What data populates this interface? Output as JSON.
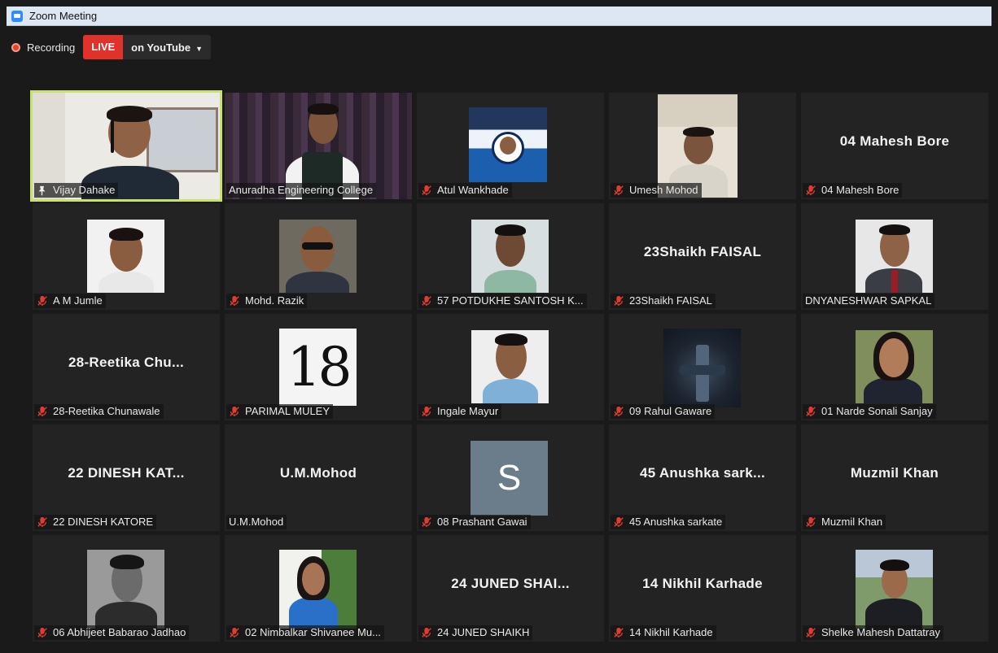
{
  "window": {
    "title": "Zoom Meeting"
  },
  "recording": {
    "label": "Recording",
    "live_badge": "LIVE",
    "destination": "on YouTube"
  },
  "colors": {
    "active_speaker_border": "#c9e26c",
    "live_red": "#e0312b",
    "tile_bg": "#232323"
  },
  "participants": [
    {
      "label": "Vijay Dahake",
      "video": "photo",
      "muted": false,
      "pinned": true,
      "active": true
    },
    {
      "label": "Anuradha Engineering College",
      "video": "photo",
      "muted": false
    },
    {
      "label": "Atul Wankhade",
      "video": "poster",
      "muted": true
    },
    {
      "label": "Umesh Mohod",
      "video": "photo",
      "muted": true
    },
    {
      "label": "04 Mahesh Bore",
      "display_name": "04 Mahesh Bore",
      "video": "off",
      "muted": true
    },
    {
      "label": "A M Jumle",
      "video": "photo",
      "muted": true
    },
    {
      "label": "Mohd. Razik",
      "video": "photo",
      "muted": true
    },
    {
      "label": "57 POTDUKHE SANTOSH K...",
      "video": "photo",
      "muted": true
    },
    {
      "label": "23Shaikh FAISAL",
      "display_name": "23Shaikh FAISAL",
      "video": "off",
      "muted": true
    },
    {
      "label": "DNYANESHWAR SAPKAL",
      "video": "photo",
      "muted": false
    },
    {
      "label": "28-Reetika Chunawale",
      "display_name": "28-Reetika  Chu...",
      "video": "off",
      "muted": true
    },
    {
      "label": "PARIMAL MULEY",
      "avatar_text": "18",
      "video": "avatar",
      "muted": true
    },
    {
      "label": "Ingale Mayur",
      "video": "photo",
      "muted": true
    },
    {
      "label": "09 Rahul Gaware",
      "video": "photo",
      "muted": true
    },
    {
      "label": "01 Narde Sonali Sanjay",
      "video": "photo",
      "muted": true
    },
    {
      "label": "22 DINESH KATORE",
      "display_name": "22 DINESH KAT...",
      "video": "off",
      "muted": true
    },
    {
      "label": "U.M.Mohod",
      "display_name": "U.M.Mohod",
      "video": "off",
      "muted": false
    },
    {
      "label": "08 Prashant Gawai",
      "avatar_text": "S",
      "video": "avatar",
      "muted": true
    },
    {
      "label": "45 Anushka sarkate",
      "display_name": "45 Anushka sark...",
      "video": "off",
      "muted": true
    },
    {
      "label": "Muzmil Khan",
      "display_name": "Muzmil Khan",
      "video": "off",
      "muted": true
    },
    {
      "label": "06 Abhijeet Babarao Jadhao",
      "video": "photo",
      "muted": true
    },
    {
      "label": "02 Nimbalkar Shivanee Mu...",
      "video": "photo",
      "muted": true
    },
    {
      "label": "24 JUNED SHAIKH",
      "display_name": "24 JUNED SHAI...",
      "video": "off",
      "muted": true
    },
    {
      "label": "14 Nikhil Karhade",
      "display_name": "14 Nikhil Karhade",
      "video": "off",
      "muted": true
    },
    {
      "label": "Shelke Mahesh Dattatray",
      "video": "photo",
      "muted": true
    }
  ]
}
